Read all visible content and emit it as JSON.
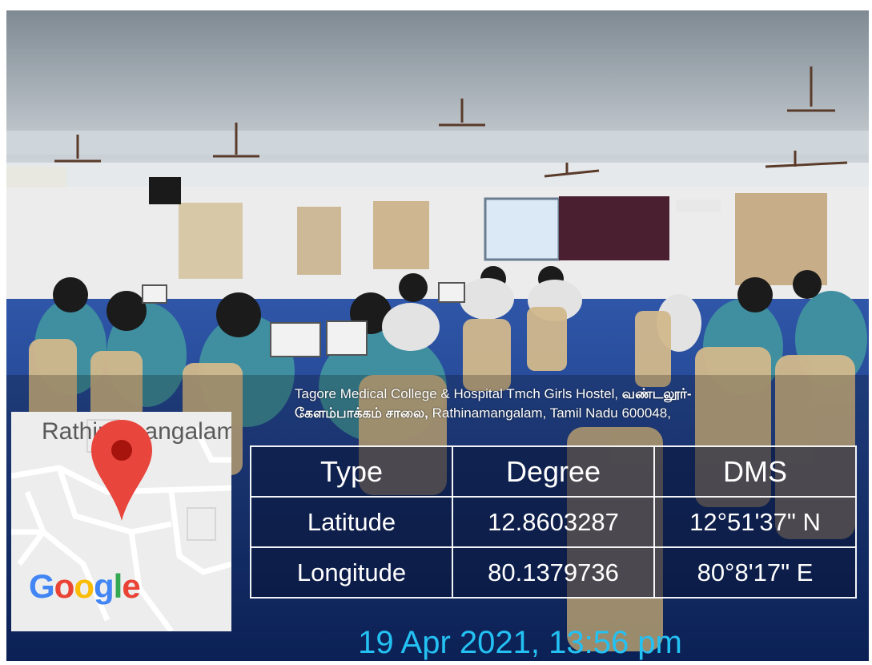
{
  "address": {
    "line1_normal": "Tagore Medical College & Hospital Tmch Girls Hostel, ",
    "line1_bold": "வண்டலூர்-",
    "line2_bold": "கேளம்பாக்கம் சாலை,",
    "line2_normal": " Rathinamangalam, Tamil Nadu 600048,"
  },
  "map": {
    "place_label": "Rathinamangalam",
    "brand": "Google",
    "pin_icon": "map-pin-icon",
    "colors": {
      "pin": "#e8453c",
      "G": "#4285f4",
      "o1": "#ea4335",
      "o2": "#fbbc05",
      "g": "#4285f4",
      "l": "#34a853",
      "e": "#ea4335"
    }
  },
  "table": {
    "headers": [
      "Type",
      "Degree",
      "DMS"
    ],
    "rows": [
      [
        "Latitude",
        "12.8603287",
        "12°51'37\" N"
      ],
      [
        "Longitude",
        "80.1379736",
        "80°8'17\" E"
      ]
    ]
  },
  "timestamp": "19 Apr 2021, 13:56 pm"
}
